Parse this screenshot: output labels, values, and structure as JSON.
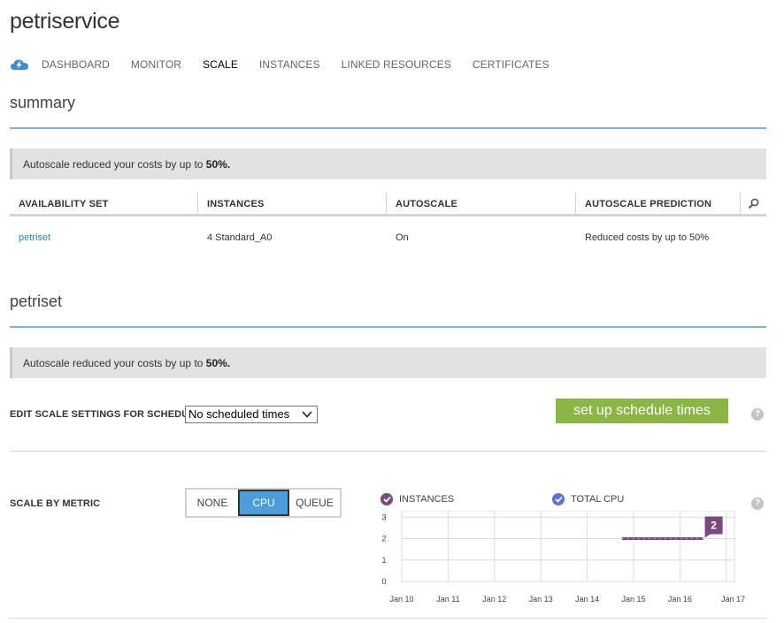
{
  "app": {
    "title": "petriservice"
  },
  "nav": {
    "icon": "cloud-service-icon",
    "items": [
      {
        "label": "DASHBOARD",
        "active": false
      },
      {
        "label": "MONITOR",
        "active": false
      },
      {
        "label": "SCALE",
        "active": true
      },
      {
        "label": "INSTANCES",
        "active": false
      },
      {
        "label": "LINKED RESOURCES",
        "active": false
      },
      {
        "label": "CERTIFICATES",
        "active": false
      }
    ]
  },
  "summary": {
    "title": "summary",
    "banner": {
      "text": "Autoscale reduced your costs by up to ",
      "highlight": "50%."
    },
    "table": {
      "columns": [
        "AVAILABILITY SET",
        "INSTANCES",
        "AUTOSCALE",
        "AUTOSCALE PREDICTION"
      ],
      "search_icon": "search-icon",
      "rows": [
        {
          "availability_set": "petriset",
          "instances": "4 Standard_A0",
          "autoscale": "On",
          "prediction": "Reduced costs by up to 50%"
        }
      ]
    }
  },
  "petriset": {
    "title": "petriset",
    "banner": {
      "text": "Autoscale reduced your costs by up to ",
      "highlight": "50%."
    },
    "schedule": {
      "label": "EDIT SCALE SETTINGS FOR SCHEDULE",
      "selected": "No scheduled times",
      "button": "set up schedule times",
      "help": "?"
    },
    "metric": {
      "label": "SCALE BY METRIC",
      "options": [
        "NONE",
        "CPU",
        "QUEUE"
      ],
      "selected": "CPU",
      "help": "?"
    }
  },
  "colors": {
    "accent_blue": "#4b9edb",
    "section_rule": "#7fb2de",
    "green_button": "#8ab645",
    "instances_series": "#7a4a7e",
    "total_cpu_series": "#5b73d4",
    "link": "#2585c8"
  },
  "chart_data": {
    "type": "line",
    "legend": [
      {
        "name": "INSTANCES",
        "checked": true,
        "color": "#7a4a7e"
      },
      {
        "name": "TOTAL CPU",
        "checked": true,
        "color": "#5b73d4"
      }
    ],
    "legend_position": "top",
    "x_ticks": [
      "Jan 10",
      "Jan 11",
      "Jan 12",
      "Jan 13",
      "Jan 14",
      "Jan 15",
      "Jan 16",
      "Jan 17"
    ],
    "y_ticks": [
      0,
      1,
      2,
      3
    ],
    "ylim": [
      0,
      3.3
    ],
    "xlim": [
      0,
      7
    ],
    "grid": true,
    "series": [
      {
        "name": "INSTANCES",
        "x_start": 4.75,
        "x_end": 6.5,
        "value": 2,
        "style": "dotted",
        "last_value_label": "2"
      }
    ],
    "xlabel": "",
    "ylabel": ""
  }
}
